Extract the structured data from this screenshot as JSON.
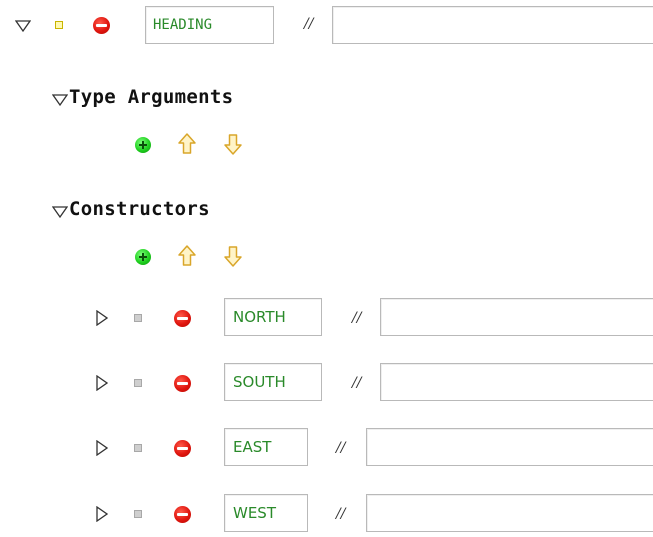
{
  "heading": {
    "name": "HEADING",
    "comment_marker": "//",
    "comment_value": ""
  },
  "sections": {
    "type_arguments_label": "Type Arguments",
    "constructors_label": "Constructors"
  },
  "constructors": [
    {
      "name": "NORTH",
      "comment_marker": "//",
      "comment_value": ""
    },
    {
      "name": "SOUTH",
      "comment_marker": "//",
      "comment_value": ""
    },
    {
      "name": "EAST",
      "comment_marker": "//",
      "comment_value": ""
    },
    {
      "name": "WEST",
      "comment_marker": "//",
      "comment_value": ""
    }
  ],
  "colors": {
    "name_text": "#2a8a2a",
    "remove": "#e0160f",
    "add": "#1fd01f",
    "arrow": "#f0c840"
  },
  "icons": {
    "collapse": "triangle-down-icon",
    "expand": "triangle-right-icon",
    "remove": "red-minus-icon",
    "add": "green-plus-icon",
    "move_up": "arrow-up-icon",
    "move_down": "arrow-down-icon"
  }
}
